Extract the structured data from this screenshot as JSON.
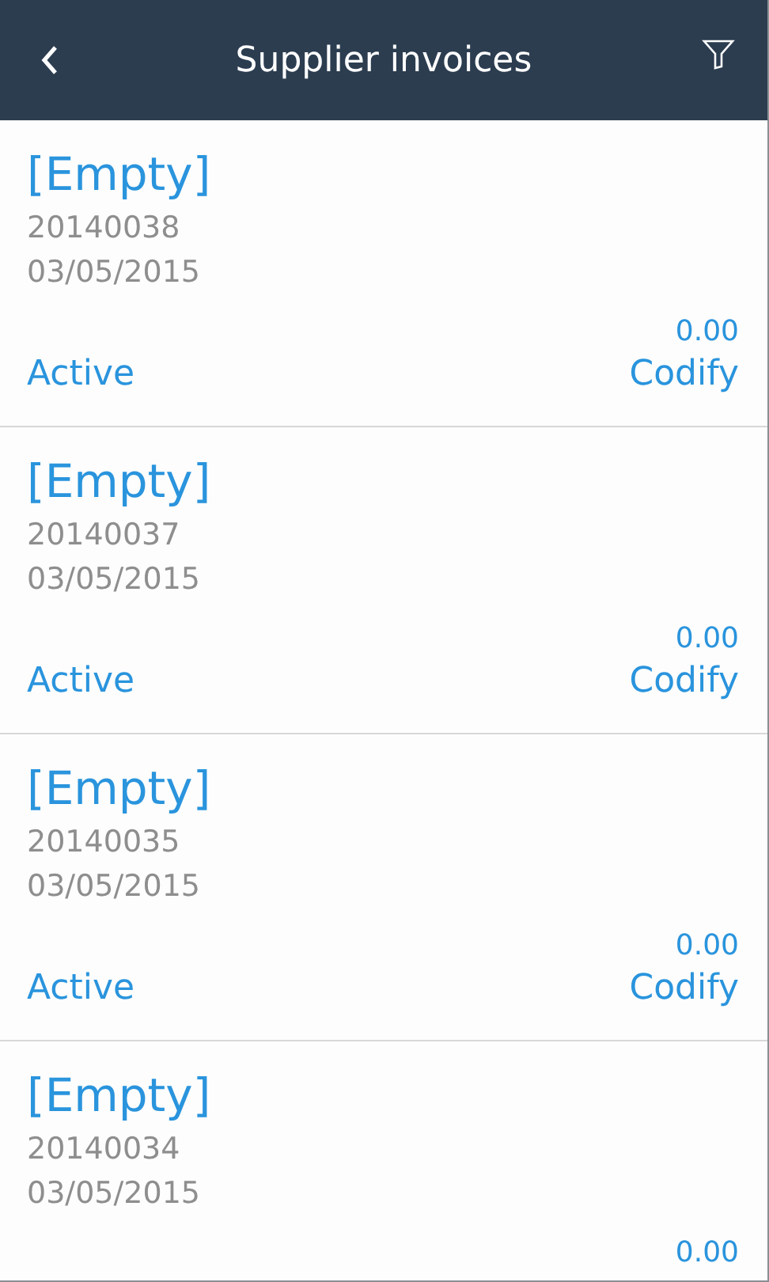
{
  "header": {
    "title": "Supplier invoices"
  },
  "invoices": [
    {
      "name": "[Empty]",
      "number": "20140038",
      "date": "03/05/2015",
      "amount": "0.00",
      "status": "Active",
      "action": "Codify"
    },
    {
      "name": "[Empty]",
      "number": "20140037",
      "date": "03/05/2015",
      "amount": "0.00",
      "status": "Active",
      "action": "Codify"
    },
    {
      "name": "[Empty]",
      "number": "20140035",
      "date": "03/05/2015",
      "amount": "0.00",
      "status": "Active",
      "action": "Codify"
    },
    {
      "name": "[Empty]",
      "number": "20140034",
      "date": "03/05/2015",
      "amount": "0.00"
    }
  ]
}
